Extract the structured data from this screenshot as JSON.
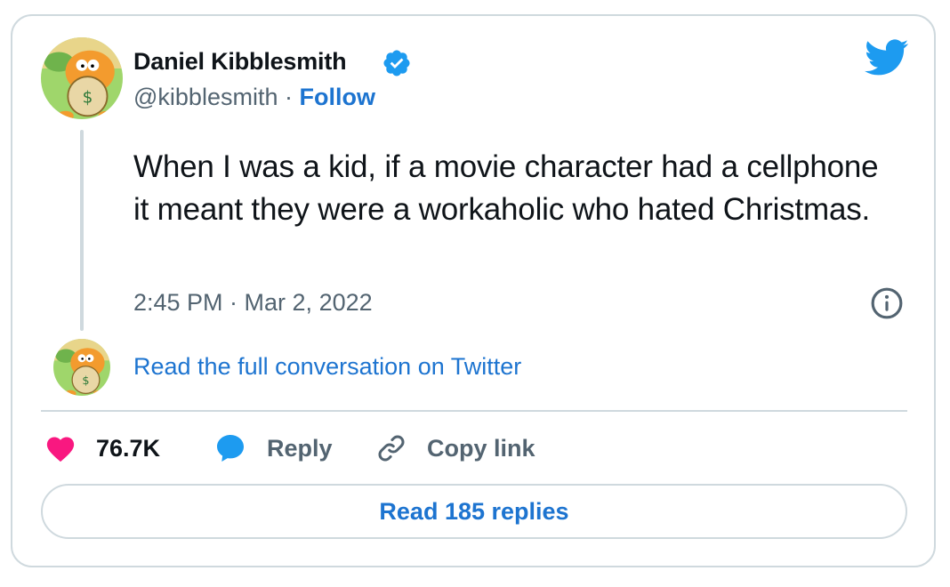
{
  "author": {
    "name": "Daniel Kibblesmith",
    "handle": "@kibblesmith",
    "separator": " · ",
    "follow_label": "Follow",
    "verified_icon": "verified-badge-icon",
    "avatar_icon": "garfield-avatar"
  },
  "tweet": {
    "text": "When I was a kid, if a movie character had a cellphone it meant they were a workaholic who hated Christmas.",
    "timestamp": "2:45 PM · Mar 2, 2022"
  },
  "conversation_link": "Read the full conversation on Twitter",
  "actions": {
    "like_count": "76.7K",
    "reply_label": "Reply",
    "copy_label": "Copy link"
  },
  "read_replies_label": "Read 185 replies",
  "colors": {
    "link_blue": "#1d74d0",
    "twitter_blue": "#1d9bf0",
    "like_pink": "#f91880",
    "border": "#cfd9de",
    "secondary_text": "#536471"
  },
  "icons": [
    "twitter-bird-icon",
    "info-icon",
    "heart-icon",
    "reply-bubble-icon",
    "link-icon"
  ]
}
